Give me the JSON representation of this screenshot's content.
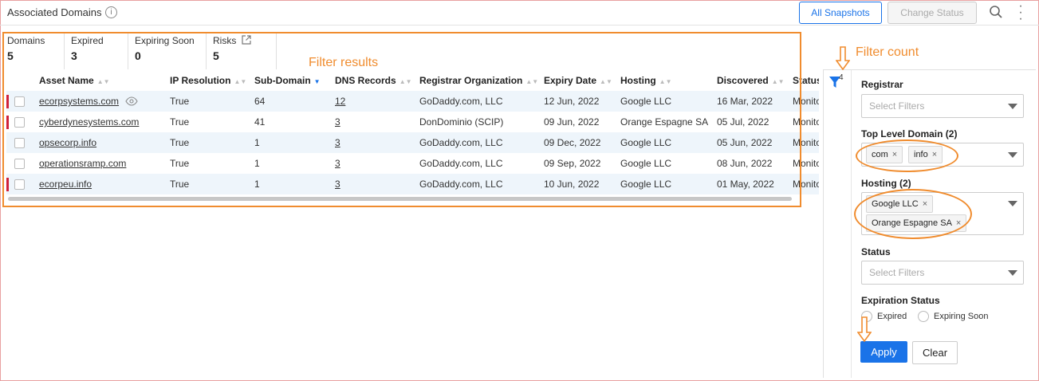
{
  "header": {
    "title": "Associated Domains",
    "info_glyph": "i",
    "all_snapshots_label": "All Snapshots",
    "change_status_label": "Change Status"
  },
  "stats": [
    {
      "label": "Domains",
      "value": "5"
    },
    {
      "label": "Expired",
      "value": "3"
    },
    {
      "label": "Expiring Soon",
      "value": "0"
    },
    {
      "label": "Risks",
      "value": "5"
    }
  ],
  "annotations": {
    "filter_results": "Filter results",
    "filter_count": "Filter count"
  },
  "table": {
    "columns": [
      "Asset Name",
      "IP Resolution",
      "Sub-Domain",
      "DNS Records",
      "Registrar Organization",
      "Expiry Date",
      "Hosting",
      "Discovered",
      "Status"
    ],
    "rows": [
      {
        "flag": true,
        "asset": "ecorpsystems.com",
        "watch": true,
        "ip": "True",
        "sub": "64",
        "dns": "12",
        "registrar": "GoDaddy.com, LLC",
        "expiry": "12 Jun, 2022",
        "hosting": "Google LLC",
        "discovered": "16 Mar, 2022",
        "status": "Monito"
      },
      {
        "flag": true,
        "asset": "cyberdynesystems.com",
        "watch": false,
        "ip": "True",
        "sub": "41",
        "dns": "3",
        "registrar": "DonDominio (SCIP)",
        "expiry": "09 Jun, 2022",
        "hosting": "Orange Espagne SA",
        "discovered": "05 Jul, 2022",
        "status": "Monito"
      },
      {
        "flag": false,
        "asset": "opsecorp.info",
        "watch": false,
        "ip": "True",
        "sub": "1",
        "dns": "3",
        "registrar": "GoDaddy.com, LLC",
        "expiry": "09 Dec, 2022",
        "hosting": "Google LLC",
        "discovered": "05 Jun, 2022",
        "status": "Monito"
      },
      {
        "flag": false,
        "asset": "operationsramp.com",
        "watch": false,
        "ip": "True",
        "sub": "1",
        "dns": "3",
        "registrar": "GoDaddy.com, LLC",
        "expiry": "09 Sep, 2022",
        "hosting": "Google LLC",
        "discovered": "08 Jun, 2022",
        "status": "Monito"
      },
      {
        "flag": true,
        "asset": "ecorpeu.info",
        "watch": false,
        "ip": "True",
        "sub": "1",
        "dns": "3",
        "registrar": "GoDaddy.com, LLC",
        "expiry": "10 Jun, 2022",
        "hosting": "Google LLC",
        "discovered": "01 May, 2022",
        "status": "Monito"
      }
    ]
  },
  "filter": {
    "count": "4",
    "registrar_label": "Registrar",
    "registrar_placeholder": "Select Filters",
    "tld_label": "Top Level Domain (2)",
    "tld_tags": [
      "com",
      "info"
    ],
    "hosting_label": "Hosting (2)",
    "hosting_tags": [
      "Google LLC",
      "Orange Espagne SA"
    ],
    "status_label": "Status",
    "status_placeholder": "Select Filters",
    "expiration_label": "Expiration Status",
    "expired_label": "Expired",
    "expiring_soon_label": "Expiring Soon",
    "apply_label": "Apply",
    "clear_label": "Clear",
    "tag_remove_glyph": "×"
  },
  "colors": {
    "accent": "#1a73e8",
    "annotation": "#f08c2e",
    "flag": "#d0213a",
    "row_alt": "#eef5fb"
  }
}
